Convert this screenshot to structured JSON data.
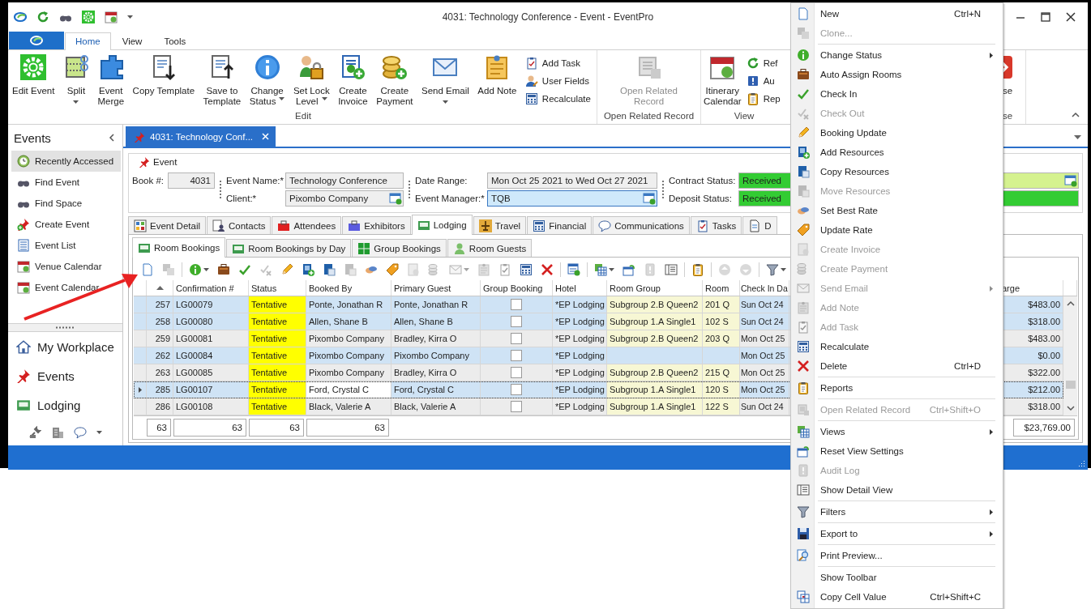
{
  "title_bar": {
    "title": "4031: Technology Conference - Event - EventPro"
  },
  "ribbon": {
    "tabs": [
      {
        "label": "Home",
        "selected": true
      },
      {
        "label": "View",
        "selected": false
      },
      {
        "label": "Tools",
        "selected": false
      }
    ],
    "groups": [
      {
        "label": "Edit",
        "items": [
          {
            "kind": "large",
            "label": "Edit Event",
            "disabled": false
          },
          {
            "kind": "large",
            "label": "Split",
            "has_menu": true,
            "disabled": false
          },
          {
            "kind": "large",
            "label": "Event\nMerge",
            "disabled": false
          },
          {
            "kind": "large",
            "label": "Copy Template",
            "disabled": false
          },
          {
            "kind": "large",
            "label": "Save to\nTemplate",
            "disabled": false
          },
          {
            "kind": "large",
            "label": "Change\nStatus",
            "has_menu": true,
            "disabled": false
          },
          {
            "kind": "large",
            "label": "Set Lock\nLevel",
            "has_menu": true,
            "disabled": false
          },
          {
            "kind": "large",
            "label": "Create\nInvoice",
            "disabled": false
          },
          {
            "kind": "large",
            "label": "Create\nPayment",
            "disabled": false
          },
          {
            "kind": "large",
            "label": "Send Email",
            "has_menu": true,
            "disabled": false
          },
          {
            "kind": "large",
            "label": "Add Note",
            "disabled": false
          },
          {
            "kind": "small",
            "label": "Add Task",
            "disabled": false
          },
          {
            "kind": "small",
            "label": "User Fields",
            "disabled": false
          },
          {
            "kind": "small",
            "label": "Recalculate",
            "disabled": false
          }
        ]
      },
      {
        "label": "Open Related Record",
        "items": [
          {
            "kind": "large",
            "label": "Open Related\nRecord",
            "disabled": true
          }
        ]
      },
      {
        "label": "View",
        "items": [
          {
            "kind": "large",
            "label": "Itinerary\nCalendar",
            "disabled": false
          },
          {
            "kind": "small",
            "label": "Ref",
            "disabled": false
          },
          {
            "kind": "small",
            "label": "Au",
            "disabled": false
          },
          {
            "kind": "small",
            "label": "Rep",
            "disabled": false
          }
        ]
      },
      {
        "label": "se",
        "items": [
          {
            "kind": "large",
            "label": "se",
            "disabled": false
          }
        ]
      }
    ]
  },
  "sidebar": {
    "title": "Events",
    "items": [
      {
        "label": "Recently Accessed",
        "selected": true
      },
      {
        "label": "Find Event",
        "selected": false
      },
      {
        "label": "Find Space",
        "selected": false
      },
      {
        "label": "Create Event",
        "selected": false
      },
      {
        "label": "Event List",
        "selected": false
      },
      {
        "label": "Venue Calendar",
        "selected": false
      },
      {
        "label": "Event Calendar",
        "selected": false
      }
    ],
    "nav": [
      {
        "label": "My Workplace"
      },
      {
        "label": "Events"
      },
      {
        "label": "Lodging"
      }
    ]
  },
  "document_tabs": [
    {
      "label": "4031: Technology Conf...",
      "selected": true
    }
  ],
  "event_panel": {
    "title": "Event",
    "fields": [
      {
        "kind": "number",
        "label": "Book #:",
        "value": "4031",
        "focused": false
      },
      {
        "kind": "text",
        "label": "Event Name:*",
        "value": "Technology Conference",
        "focused": false
      },
      {
        "kind": "lookup",
        "label": "Client:*",
        "value": "Pixombo Company",
        "focused": false
      },
      {
        "kind": "text",
        "label": "Date Range:",
        "value": "Mon Oct 25 2021 to Wed Oct 27 2021",
        "focused": false
      },
      {
        "kind": "lookup",
        "label": "Event Manager:*",
        "value": "TQB",
        "focused": true
      },
      {
        "kind": "status",
        "label": "Contract Status:",
        "value": "Received",
        "color": "#33cc33",
        "focused": false
      },
      {
        "kind": "status",
        "label": "Deposit Status:",
        "value": "Received",
        "color": "#33cc33",
        "focused": false
      },
      {
        "kind": "lookup",
        "color": "#d5f28f",
        "focused": false
      }
    ]
  },
  "page_tabs": [
    {
      "label": "Event Detail",
      "selected": false
    },
    {
      "label": "Contacts",
      "selected": false
    },
    {
      "label": "Attendees",
      "selected": false
    },
    {
      "label": "Exhibitors",
      "selected": false
    },
    {
      "label": "Lodging",
      "selected": true
    },
    {
      "label": "Travel",
      "selected": false
    },
    {
      "label": "Financial",
      "selected": false
    },
    {
      "label": "Communications",
      "selected": false
    },
    {
      "label": "Tasks",
      "selected": false
    },
    {
      "label": "D",
      "selected": false
    }
  ],
  "sub_tabs": [
    {
      "label": "Room Bookings",
      "selected": true
    },
    {
      "label": "Room Bookings by Day",
      "selected": false
    },
    {
      "label": "Group Bookings",
      "selected": false
    },
    {
      "label": "Room Guests",
      "selected": false
    }
  ],
  "toolbar": [
    {
      "kind": "button",
      "disabled": false
    },
    {
      "kind": "button",
      "disabled": true
    },
    {
      "kind": "separator"
    },
    {
      "kind": "menu_button",
      "disabled": false
    },
    {
      "kind": "button",
      "disabled": false
    },
    {
      "kind": "button",
      "disabled": false
    },
    {
      "kind": "button",
      "disabled": true
    },
    {
      "kind": "button",
      "disabled": false
    },
    {
      "kind": "button",
      "disabled": false
    },
    {
      "kind": "button",
      "disabled": false
    },
    {
      "kind": "button",
      "disabled": true
    },
    {
      "kind": "button",
      "disabled": false
    },
    {
      "kind": "button",
      "disabled": false
    },
    {
      "kind": "button",
      "disabled": true
    },
    {
      "kind": "button",
      "disabled": true
    },
    {
      "kind": "menu_button",
      "disabled": true
    },
    {
      "kind": "button",
      "disabled": true
    },
    {
      "kind": "button",
      "disabled": true
    },
    {
      "kind": "button",
      "disabled": false
    },
    {
      "kind": "button",
      "disabled": false
    },
    {
      "kind": "separator"
    },
    {
      "kind": "button",
      "disabled": false
    },
    {
      "kind": "separator"
    },
    {
      "kind": "menu_button",
      "disabled": false
    },
    {
      "kind": "button",
      "disabled": false
    },
    {
      "kind": "button",
      "disabled": true
    },
    {
      "kind": "button",
      "disabled": false
    },
    {
      "kind": "separator"
    },
    {
      "kind": "button",
      "disabled": false
    },
    {
      "kind": "separator"
    },
    {
      "kind": "button",
      "disabled": true
    },
    {
      "kind": "button",
      "disabled": true
    },
    {
      "kind": "separator"
    },
    {
      "kind": "menu_button",
      "disabled": false
    }
  ],
  "grid": {
    "columns": [
      {
        "sorted": true
      },
      {
        "label": "Confirmation #",
        "sorted": false
      },
      {
        "label": "Status",
        "sorted": false
      },
      {
        "label": "Booked By",
        "sorted": false
      },
      {
        "label": "Primary Guest",
        "sorted": false
      },
      {
        "label": "Group Booking",
        "sorted": false
      },
      {
        "label": "Hotel",
        "sorted": false
      },
      {
        "label": "Room Group",
        "sorted": false
      },
      {
        "label": "Room",
        "sorted": false
      },
      {
        "label": "Check In Da",
        "sorted": false
      },
      {
        "label": "arge",
        "sorted": false
      }
    ],
    "rows": [
      {
        "id": "257",
        "confirmation": "LG00079",
        "status": "Tentative",
        "booked_by": "Ponte, Jonathan R",
        "primary_guest": "Ponte, Jonathan R",
        "group_booking_checked": false,
        "hotel": "*EP Lodging",
        "room_group": "Subgroup 2.B Queen2",
        "room": "201 Q",
        "check_in": "Sun Oct 24",
        "charge": "$483.00",
        "selected": true,
        "current": false
      },
      {
        "id": "258",
        "confirmation": "LG00080",
        "status": "Tentative",
        "booked_by": "Allen, Shane B",
        "primary_guest": "Allen, Shane B",
        "group_booking_checked": false,
        "hotel": "*EP Lodging",
        "room_group": "Subgroup 1.A Single1",
        "room": "102 S",
        "check_in": "Sun Oct 24",
        "charge": "$318.00",
        "selected": true,
        "current": false
      },
      {
        "id": "259",
        "confirmation": "LG00081",
        "status": "Tentative",
        "booked_by": "Pixombo Company",
        "primary_guest": "Bradley, Kirra O",
        "group_booking_checked": false,
        "hotel": "*EP Lodging",
        "room_group": "Subgroup 2.B Queen2",
        "room": "203 Q",
        "check_in": "Mon Oct 25",
        "charge": "$483.00",
        "selected": false,
        "current": false
      },
      {
        "id": "262",
        "confirmation": "LG00084",
        "status": "Tentative",
        "booked_by": "Pixombo Company",
        "primary_guest": "Pixombo Company",
        "group_booking_checked": false,
        "hotel": "*EP Lodging",
        "check_in": "Mon Oct 25",
        "charge": "$0.00",
        "selected": true,
        "current": false
      },
      {
        "id": "263",
        "confirmation": "LG00085",
        "status": "Tentative",
        "booked_by": "Pixombo Company",
        "primary_guest": "Bradley, Kirra O",
        "group_booking_checked": false,
        "hotel": "*EP Lodging",
        "room_group": "Subgroup 2.B Queen2",
        "room": "215 Q",
        "check_in": "Mon Oct 25",
        "charge": "$322.00",
        "selected": false,
        "current": false
      },
      {
        "id": "285",
        "confirmation": "LG00107",
        "status": "Tentative",
        "booked_by": "Ford, Crystal C",
        "primary_guest": "Ford, Crystal C",
        "group_booking_checked": false,
        "hotel": "*EP Lodging",
        "room_group": "Subgroup 1.A Single1",
        "room": "120 S",
        "check_in": "Mon Oct 25",
        "charge": "$212.00",
        "selected": true,
        "current": true
      },
      {
        "id": "286",
        "confirmation": "LG00108",
        "status": "Tentative",
        "booked_by": "Black, Valerie A",
        "primary_guest": "Black, Valerie A",
        "group_booking_checked": false,
        "hotel": "*EP Lodging",
        "room_group": "Subgroup 1.A Single1",
        "room": "122 S",
        "check_in": "Sun Oct 24",
        "charge": "$318.00",
        "selected": false,
        "current": false
      }
    ],
    "footer": {
      "id": "63",
      "confirmation": "63",
      "status": "63",
      "booked_by": "63",
      "charge": "$23,769.00"
    }
  },
  "context_menu": {
    "items": [
      {
        "kind": "item",
        "label": "New",
        "shortcut": "Ctrl+N",
        "disabled": false
      },
      {
        "kind": "item",
        "label": "Clone...",
        "disabled": true
      },
      {
        "kind": "separator"
      },
      {
        "kind": "item",
        "label": "Change Status",
        "submenu": true,
        "disabled": false
      },
      {
        "kind": "item",
        "label": "Auto Assign Rooms",
        "disabled": false
      },
      {
        "kind": "item",
        "label": "Check In",
        "disabled": false
      },
      {
        "kind": "item",
        "label": "Check Out",
        "disabled": true
      },
      {
        "kind": "item",
        "label": "Booking Update",
        "disabled": false
      },
      {
        "kind": "item",
        "label": "Add Resources",
        "disabled": false
      },
      {
        "kind": "item",
        "label": "Copy Resources",
        "disabled": false
      },
      {
        "kind": "item",
        "label": "Move Resources",
        "disabled": true
      },
      {
        "kind": "item",
        "label": "Set Best Rate",
        "disabled": false
      },
      {
        "kind": "item",
        "label": "Update Rate",
        "disabled": false
      },
      {
        "kind": "item",
        "label": "Create Invoice",
        "disabled": true
      },
      {
        "kind": "item",
        "label": "Create Payment",
        "disabled": true
      },
      {
        "kind": "item",
        "label": "Send Email",
        "submenu": true,
        "disabled": true
      },
      {
        "kind": "item",
        "label": "Add Note",
        "disabled": true
      },
      {
        "kind": "item",
        "label": "Add Task",
        "disabled": true
      },
      {
        "kind": "item",
        "label": "Recalculate",
        "disabled": false
      },
      {
        "kind": "item",
        "label": "Delete",
        "shortcut": "Ctrl+D",
        "disabled": false
      },
      {
        "kind": "separator"
      },
      {
        "kind": "item",
        "label": "Reports",
        "disabled": false
      },
      {
        "kind": "separator"
      },
      {
        "kind": "item",
        "label": "Open Related Record",
        "shortcut": "Ctrl+Shift+O",
        "disabled": true
      },
      {
        "kind": "separator"
      },
      {
        "kind": "item",
        "label": "Views",
        "submenu": true,
        "disabled": false
      },
      {
        "kind": "item",
        "label": "Reset View Settings",
        "disabled": false
      },
      {
        "kind": "item",
        "label": "Audit Log",
        "disabled": true
      },
      {
        "kind": "item",
        "label": "Show Detail View",
        "disabled": false
      },
      {
        "kind": "separator"
      },
      {
        "kind": "item",
        "label": "Filters",
        "submenu": true,
        "disabled": false
      },
      {
        "kind": "separator"
      },
      {
        "kind": "item",
        "label": "Export to",
        "submenu": true,
        "disabled": false
      },
      {
        "kind": "separator"
      },
      {
        "kind": "item",
        "label": "Print Preview...",
        "disabled": false
      },
      {
        "kind": "separator"
      },
      {
        "kind": "item",
        "label": "Show Toolbar",
        "disabled": false
      },
      {
        "kind": "item",
        "label": "Copy Cell Value",
        "shortcut": "Ctrl+Shift+C",
        "disabled": false
      }
    ]
  }
}
